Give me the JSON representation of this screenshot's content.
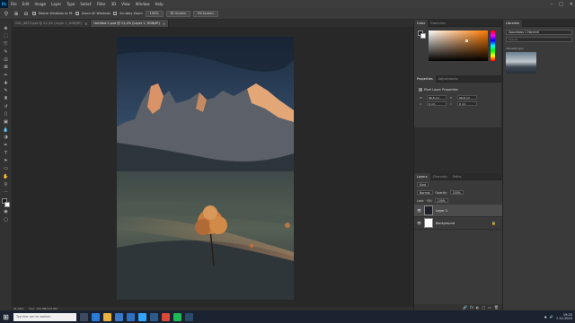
{
  "app": {
    "logo": "Ps",
    "menu": [
      "File",
      "Edit",
      "Image",
      "Layer",
      "Type",
      "Select",
      "Filter",
      "3D",
      "View",
      "Window",
      "Help"
    ],
    "window_controls": [
      "–",
      "□",
      "✕"
    ]
  },
  "options_bar": {
    "zoom_in_icon": "⊕",
    "zoom_out_icon": "⊖",
    "resize_windows": "Resize Windows to Fit",
    "zoom_all_windows": "Zoom All Windows",
    "scrubby_zoom": "Scrubby Zoom",
    "zoom_100": "100%",
    "fit_screen": "Fit Screen",
    "fill_screen": "Fill Screen"
  },
  "tabs": [
    {
      "label": "DSC_8873.psd @ 22,4% (Layer 1, RGB/8*)",
      "active": false
    },
    {
      "label": "Untitled-1.psd @ 21,4% (Layer 1, RGB/8*)",
      "active": true
    }
  ],
  "status": {
    "zoom": "21,49%",
    "doc": "Doc: 133,8M/133,8M"
  },
  "color_panel": {
    "tabs": [
      "Color",
      "Swatches"
    ],
    "foreground": "#1a1a1a",
    "background": "#ffffff"
  },
  "properties_panel": {
    "tabs": [
      "Properties",
      "Adjustments"
    ],
    "title": "Pixel Layer Properties",
    "w_label": "W",
    "w_value": "96,8 cm",
    "h_label": "H",
    "h_value": "96,8 cm",
    "x_label": "X",
    "x_value": "0 cm",
    "y_label": "Y",
    "y_value": "0 cm",
    "go_label": "GO"
  },
  "layers_panel": {
    "tabs": [
      "Layers",
      "Channels",
      "Paths"
    ],
    "filter": "Kind",
    "blend_mode": "Normal",
    "opacity_label": "Opacity:",
    "opacity": "100%",
    "lock_label": "Lock:",
    "fill_label": "Fill:",
    "fill": "100%",
    "layers": [
      {
        "name": "Layer 1",
        "active": true,
        "visible": true,
        "thumb": "dark"
      },
      {
        "name": "Background",
        "active": false,
        "visible": true,
        "thumb": "white",
        "locked": true
      }
    ],
    "footer_icons": [
      "fx",
      "◐",
      "▢",
      "▭",
      "🗑"
    ]
  },
  "libraries_panel": {
    "tab": "Libraries",
    "library": "Spaceboss 1 Harrenti",
    "search_placeholder": "Search",
    "section": "Afbeeldingen"
  },
  "taskbar": {
    "search_placeholder": "Typ hier om te zoeken",
    "time": "19:23",
    "date": "7-12-2019",
    "apps": [
      {
        "name": "task-view",
        "color": "#3d4b60"
      },
      {
        "name": "edge",
        "color": "#2b7bd8"
      },
      {
        "name": "explorer",
        "color": "#e8b341"
      },
      {
        "name": "store",
        "color": "#3a79c9"
      },
      {
        "name": "mail",
        "color": "#2f6fbf"
      },
      {
        "name": "photoshop",
        "color": "#31a8ff"
      },
      {
        "name": "lightroom",
        "color": "#2f5b8a"
      },
      {
        "name": "chrome",
        "color": "#d9493a"
      },
      {
        "name": "spotify",
        "color": "#1db954"
      },
      {
        "name": "steam",
        "color": "#294a6b"
      }
    ]
  }
}
